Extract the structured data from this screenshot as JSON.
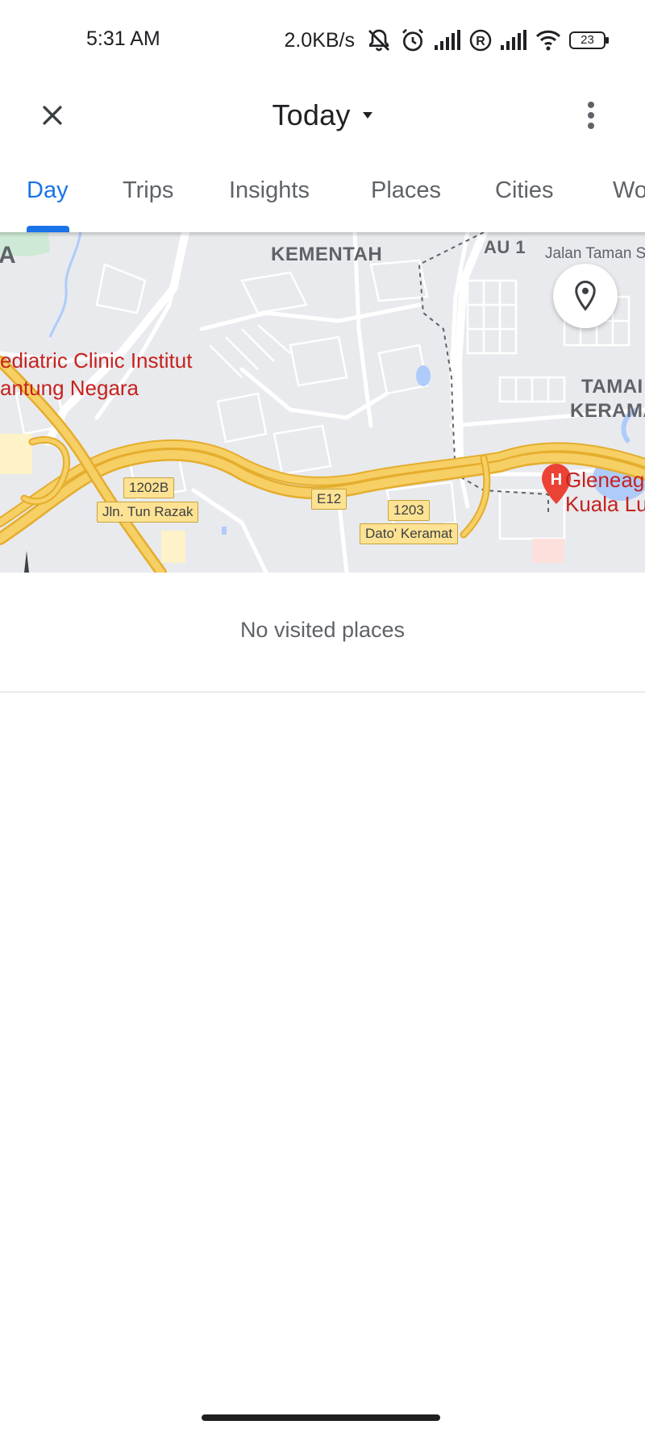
{
  "status_bar": {
    "time": "5:31 AM",
    "network_speed": "2.0KB/s",
    "battery_level": "23",
    "icons": [
      "bell-off-icon",
      "alarm-icon",
      "signal-icon",
      "roaming-r-icon",
      "signal-icon",
      "wifi-icon",
      "battery-icon"
    ]
  },
  "app_bar": {
    "title": "Today",
    "close_icon": "close-icon",
    "dropdown_icon": "caret-down-icon",
    "more_icon": "more-vertical-icon"
  },
  "tabs": [
    {
      "label": "Day",
      "active": true
    },
    {
      "label": "Trips",
      "active": false
    },
    {
      "label": "Insights",
      "active": false
    },
    {
      "label": "Places",
      "active": false
    },
    {
      "label": "Cities",
      "active": false
    },
    {
      "label": "Wo",
      "active": false
    }
  ],
  "map": {
    "labels": {
      "district_a": "A",
      "kementah": "KEMENTAH",
      "au1": "AU 1",
      "jalan_taman": "Jalan Taman S",
      "poi_clinic_line1": "ediatric Clinic Institut",
      "poi_clinic_line2": "antung Negara",
      "taman_line1": "TAMAI",
      "taman_line2": "KERAMA",
      "hospital_line1": "Gleneag",
      "hospital_line2": "Kuala Lu"
    },
    "shields": {
      "s1202b": "1202B",
      "tun_razak": "Jln. Tun Razak",
      "e12": "E12",
      "s1203": "1203",
      "dato_keramat": "Dato' Keramat"
    },
    "location_button_icon": "location-pin-icon",
    "hospital_icon": "hospital-pin-icon",
    "colors": {
      "land": "#e8eaed",
      "highway": "#f6cf65",
      "highway_edge": "#e5ad2c",
      "water": "#aecbfa",
      "park": "#ceead6",
      "poi": "#c5221f",
      "accent": "#1a73e8"
    }
  },
  "content": {
    "empty_message": "No visited places"
  }
}
